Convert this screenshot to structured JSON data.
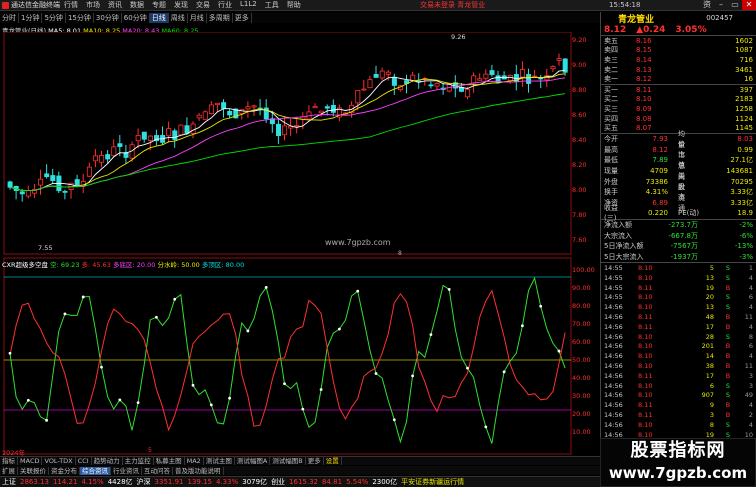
{
  "titlebar": {
    "app_name": "通达信金融终端",
    "menus": [
      "行情",
      "市场",
      "资讯",
      "数据",
      "专题",
      "发现",
      "交易",
      "行业",
      "L1L2",
      "工具",
      "帮助"
    ],
    "promo": "交易未登录  青龙管业",
    "clock": "15:54:18",
    "win_buttons": [
      "资",
      "–",
      "▭",
      "✕"
    ]
  },
  "periodbar": {
    "items": [
      "分时",
      "1分钟",
      "5分钟",
      "15分钟",
      "30分钟",
      "60分钟",
      "日线",
      "周线",
      "月线",
      "多周期",
      "更多"
    ],
    "active": "日线"
  },
  "chart_info": {
    "title": "青龙管业(日线)",
    "ma5": "MA5: 8.01",
    "ma10": "MA10: 8.25",
    "ma20": "MA20: 8.43",
    "ma60": "MA60: 8.25"
  },
  "indicator_info": {
    "name": "CXR超级多空盘",
    "empty_label": "空: 69.23",
    "duo_label": "多: 45.63",
    "duokong": "多底区: 20.00",
    "fenshui": "分水岭: 50.00",
    "duotou": "多顶区: 80.00"
  },
  "price_axis": [
    "9.20",
    "9.00",
    "8.80",
    "8.60",
    "8.40",
    "8.20",
    "8.00",
    "7.80",
    "7.60"
  ],
  "ind_axis": [
    "100.00",
    "90.00",
    "80.00",
    "70.00",
    "60.00",
    "50.00",
    "40.00",
    "30.00",
    "20.00",
    "10.00"
  ],
  "annotations": {
    "high": "9.26",
    "low": "7.55",
    "date_tag": "8",
    "year_tag": "2024年",
    "mid_tag": "5"
  },
  "watermark_center": "www.7gpzb.com",
  "bottomtabs": [
    "指标",
    "MACD",
    "VOL-TDX",
    "CCI",
    "趋势动力",
    "主力监控",
    "私募主图",
    "MA2",
    "测试主图",
    "测试幅图A",
    "测试幅图B",
    "更多",
    "设置"
  ],
  "bottomtabs2": [
    "扩展",
    "关联报价",
    "资金分布",
    "综合资讯",
    "行业资讯",
    "互动问答",
    "普及版功能说明"
  ],
  "statusbar": {
    "sh": "上证",
    "sh_val": "2863.13",
    "sh_chg": "114.21",
    "sh_pct": "4.15%",
    "sh_amt": "4428亿",
    "sz": "沪深",
    "sz_val": "3351.91",
    "sz_chg": "139.15",
    "sz_pct": "4.33%",
    "sz_amt": "3079亿",
    "cy": "创业",
    "cy_val": "1615.32",
    "cy_chg": "84.81",
    "cy_pct": "5.54%",
    "cy_amt": "2300亿",
    "news": "平安证券新疆运行情"
  },
  "rpanel": {
    "name": "青龙管业",
    "code": "002457",
    "price": "8.12",
    "change": "▲0.24",
    "pct": "3.05%",
    "sells": [
      {
        "l": "卖五",
        "p": "8.16",
        "v": "1602"
      },
      {
        "l": "卖四",
        "p": "8.15",
        "v": "1087"
      },
      {
        "l": "卖三",
        "p": "8.14",
        "v": "716"
      },
      {
        "l": "卖二",
        "p": "8.13",
        "v": "3461"
      },
      {
        "l": "卖一",
        "p": "8.12",
        "v": "16"
      }
    ],
    "buys": [
      {
        "l": "买一",
        "p": "8.11",
        "v": "397"
      },
      {
        "l": "买二",
        "p": "8.10",
        "v": "2183"
      },
      {
        "l": "买三",
        "p": "8.09",
        "v": "1258"
      },
      {
        "l": "买四",
        "p": "8.08",
        "v": "1124"
      },
      {
        "l": "买五",
        "p": "8.07",
        "v": "1145"
      }
    ],
    "quotes": [
      {
        "a": "今开",
        "b": "7.93",
        "c": "均价",
        "d": "8.03"
      },
      {
        "a": "最高",
        "b": "8.12",
        "c": "量比",
        "d": "0.99"
      },
      {
        "a": "最低",
        "b": "7.89",
        "c": "市值",
        "d": "27.1亿"
      },
      {
        "a": "现量",
        "b": "4709",
        "c": "总量",
        "d": "143681"
      },
      {
        "a": "外盘",
        "b": "73386",
        "c": "内盘",
        "d": "70295"
      },
      {
        "a": "换手",
        "b": "4.31%",
        "c": "股本",
        "d": "3.33亿"
      },
      {
        "a": "净资",
        "b": "6.89",
        "c": "流通",
        "d": "3.33亿"
      },
      {
        "a": "收益(三)",
        "b": "0.220",
        "c": "PE(动)",
        "d": "18.9"
      }
    ],
    "flows": [
      {
        "a": "净流入额",
        "b": "-273.7万",
        "c": "-2%"
      },
      {
        "a": "大宗流入",
        "b": "-667.8万",
        "c": "-6%"
      },
      {
        "a": "5日净流入额",
        "b": "-7567万",
        "c": "-13%"
      },
      {
        "a": "5日大宗流入",
        "b": "-1937万",
        "c": "-3%"
      }
    ],
    "ticks": [
      {
        "t": "14:55",
        "p": "8.10",
        "v": "5",
        "s": "S",
        "n": "1"
      },
      {
        "t": "14:55",
        "p": "8.10",
        "v": "13",
        "s": "S",
        "n": "4"
      },
      {
        "t": "14:55",
        "p": "8.11",
        "v": "19",
        "s": "B",
        "n": "4"
      },
      {
        "t": "14:55",
        "p": "8.10",
        "v": "20",
        "s": "S",
        "n": "6"
      },
      {
        "t": "14:56",
        "p": "8.10",
        "v": "13",
        "s": "S",
        "n": "4"
      },
      {
        "t": "14:56",
        "p": "8.11",
        "v": "48",
        "s": "B",
        "n": "11"
      },
      {
        "t": "14:56",
        "p": "8.11",
        "v": "17",
        "s": "B",
        "n": "4"
      },
      {
        "t": "14:56",
        "p": "8.10",
        "v": "28",
        "s": "S",
        "n": "8"
      },
      {
        "t": "14:56",
        "p": "8.10",
        "v": "201",
        "s": "B",
        "n": "6"
      },
      {
        "t": "14:56",
        "p": "8.10",
        "v": "14",
        "s": "B",
        "n": "4"
      },
      {
        "t": "14:56",
        "p": "8.10",
        "v": "38",
        "s": "B",
        "n": "11"
      },
      {
        "t": "14:56",
        "p": "8.11",
        "v": "17",
        "s": "B",
        "n": "3"
      },
      {
        "t": "14:56",
        "p": "8.10",
        "v": "6",
        "s": "S",
        "n": "3"
      },
      {
        "t": "14:56",
        "p": "8.10",
        "v": "907",
        "s": "S",
        "n": "49"
      },
      {
        "t": "14:56",
        "p": "8.11",
        "v": "9",
        "s": "B",
        "n": "4"
      },
      {
        "t": "14:56",
        "p": "8.11",
        "v": "3",
        "s": "B",
        "n": "2"
      },
      {
        "t": "14:56",
        "p": "8.10",
        "v": "8",
        "s": "S",
        "n": "4"
      },
      {
        "t": "14:56",
        "p": "8.10",
        "v": "19",
        "s": "S",
        "n": "10"
      },
      {
        "t": "14:56",
        "p": "8.10",
        "v": "16",
        "s": "S",
        "n": "5"
      }
    ],
    "footer": "图文F10  明细"
  },
  "watermark": {
    "line1": "股票指标网",
    "line2": "www.7gpzb.com"
  }
}
